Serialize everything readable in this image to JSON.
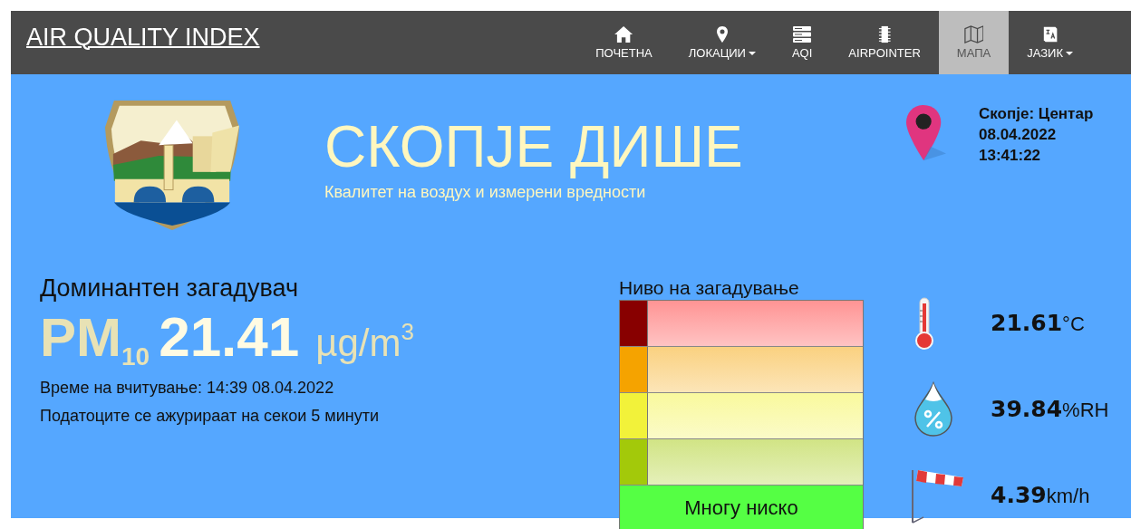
{
  "navbar": {
    "brand": "AIR QUALITY INDEX",
    "items": [
      {
        "label": "ПОЧЕТНА",
        "dropdown": false,
        "selected": false
      },
      {
        "label": "ЛОКАЦИИ",
        "dropdown": true,
        "selected": false
      },
      {
        "label": "AQI",
        "dropdown": false,
        "selected": false
      },
      {
        "label": "AIRPOINTER",
        "dropdown": false,
        "selected": false
      },
      {
        "label": "МАПА",
        "dropdown": false,
        "selected": true
      },
      {
        "label": "ЈАЗИК",
        "dropdown": true,
        "selected": false
      }
    ]
  },
  "header": {
    "title": "СКОПЈЕ ДИШЕ",
    "subtitle": "Квалитет на воздух и измерени вредности",
    "location": "Скопје: Центар",
    "date": "08.04.2022",
    "time": "13:41:22"
  },
  "pollutant": {
    "heading": "Доминантен загадувач",
    "name": "PM$_{10}$",
    "value": "21.41",
    "unit": "µg/m$^{3}$",
    "read_time": "Време на вчитување: 14:39 08.04.2022",
    "update_note": "Податоците се ажурираат на секои 5 минути"
  },
  "scale": {
    "title": "Ниво на загадување",
    "levels": [
      {
        "color": "#880000",
        "selected": false
      },
      {
        "color": "#f5a300",
        "selected": false
      },
      {
        "color": "#f2f23a",
        "selected": false
      },
      {
        "color": "#a3c90a",
        "selected": false
      },
      {
        "color": "#55ff44",
        "selected": true,
        "label": "Многу ниско"
      }
    ]
  },
  "weather": [
    {
      "kind": "temperature",
      "value": "21.61",
      "unit": "°C"
    },
    {
      "kind": "humidity",
      "value": "39.84",
      "unit": "%RH"
    },
    {
      "kind": "wind",
      "value": "4.39",
      "unit": "km/h"
    }
  ]
}
